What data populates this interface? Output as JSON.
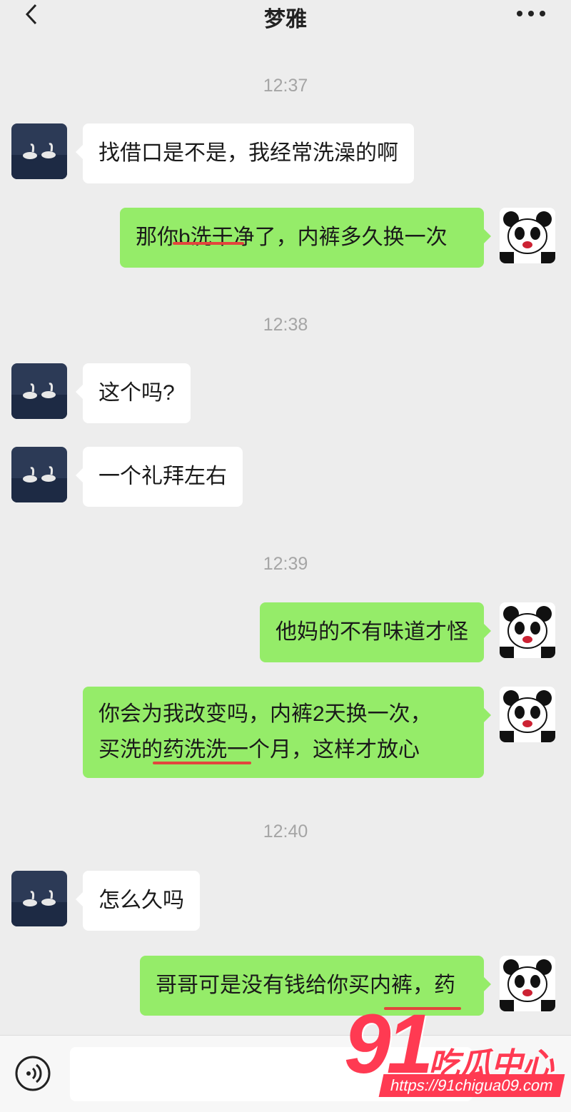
{
  "header": {
    "title": "梦雅",
    "back_icon": "chevron-left-icon",
    "more_icon": "more-dots-icon"
  },
  "messages": [
    {
      "time": "12:37"
    },
    {
      "from": "left",
      "text": "找借口是不是，我经常洗澡的啊"
    },
    {
      "from": "right",
      "text": "那你b洗干净了，内裤多久换一次"
    },
    {
      "time": "12:38"
    },
    {
      "from": "left",
      "text": "这个吗?"
    },
    {
      "from": "left",
      "text": "一个礼拜左右"
    },
    {
      "time": "12:39"
    },
    {
      "from": "right",
      "text": "他妈的不有味道才怪"
    },
    {
      "from": "right",
      "lines": [
        "你会为我改变吗，内裤2天换一次，",
        "买洗的药洗洗一个月，这样才放心"
      ]
    },
    {
      "time": "12:40"
    },
    {
      "from": "left",
      "text": "怎么久吗"
    },
    {
      "from": "right",
      "text": "哥哥可是没有钱给你买内裤，药"
    }
  ],
  "avatars": {
    "contact": "swan-photo-avatar",
    "self": "panda-avatar"
  },
  "input_bar": {
    "voice_icon": "voice-icon",
    "value": ""
  },
  "watermark": {
    "number": "91",
    "text": "吃瓜中心",
    "url": "https://91chigua09.com"
  },
  "colors": {
    "background": "#ededed",
    "sent_bubble": "#95ec69",
    "received_bubble": "#ffffff",
    "underline": "#e2463c",
    "watermark": "#ff3a52"
  }
}
